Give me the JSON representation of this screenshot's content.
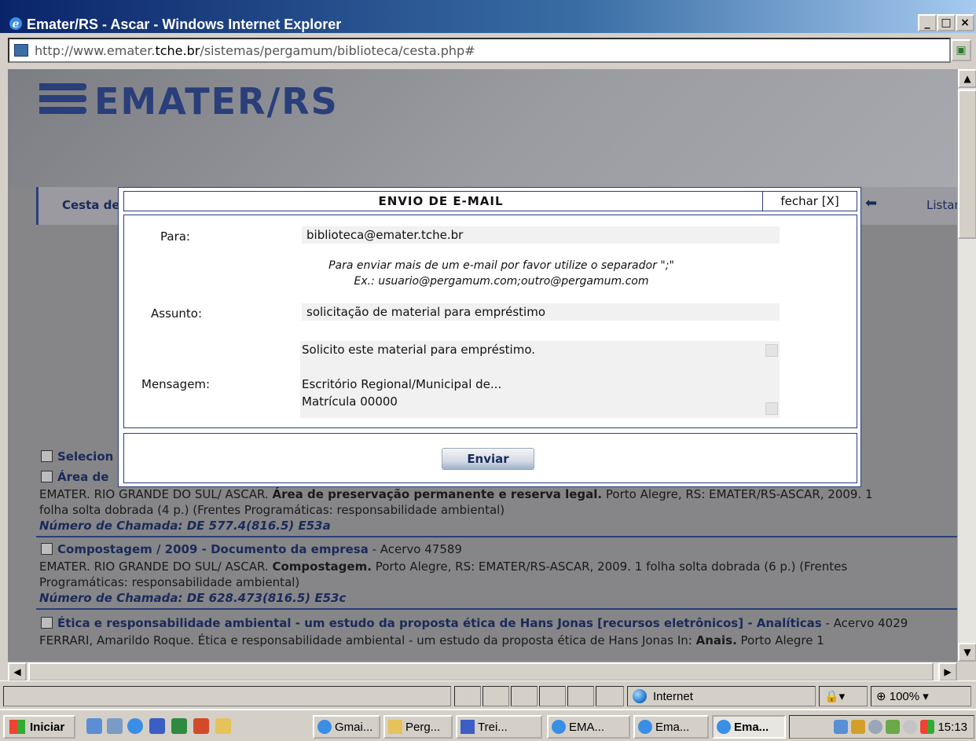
{
  "window": {
    "title": "Emater/RS - Ascar - Windows Internet Explorer",
    "url_prefix": "http://www.emater.",
    "url_host": "tche.br",
    "url_path": "/sistemas/pergamum/biblioteca/cesta.php#"
  },
  "site": {
    "logo_text": "EMATER/RS",
    "nav_left": "Cesta de",
    "nav_right": "Listar"
  },
  "modal": {
    "title": "ENVIO DE E-MAIL",
    "close_label": "fechar [X]",
    "to_label": "Para:",
    "to_value": "biblioteca@emater.tche.br",
    "hint_line1": "Para enviar mais de um e-mail por favor utilize o separador \";\"",
    "hint_line2": "Ex.: usuario@pergamum.com;outro@pergamum.com",
    "subject_label": "Assunto:",
    "subject_value": "solicitação de material para empréstimo",
    "message_label": "Mensagem:",
    "message_lines": [
      "Solicito este material para empréstimo.",
      "",
      "Escritório Regional/Municipal de...",
      "Matrícula 00000"
    ],
    "send_label": "Enviar"
  },
  "results": {
    "select_all_fragment": "Selecion",
    "item1_title_fragment": "Área de",
    "item1_meta_prefix": "EMATER. RIO GRANDE DO SUL/ ASCAR. ",
    "item1_meta_bold": "Área de preservação permanente e reserva legal.",
    "item1_meta_suffix": " Porto Alegre, RS: EMATER/RS-ASCAR, 2009. 1",
    "item1_meta_line2": "folha solta dobrada (4 p.) (Frentes Programáticas: responsabilidade ambiental)",
    "item1_call": "Número de Chamada: DE 577.4(816.5) E53a",
    "item2_title": "Compostagem / 2009 - Documento da empresa",
    "item2_acervo": " - Acervo 47589",
    "item2_meta_prefix": "EMATER. RIO GRANDE DO SUL/ ASCAR. ",
    "item2_meta_bold": "Compostagem.",
    "item2_meta_suffix": " Porto Alegre, RS: EMATER/RS-ASCAR, 2009. 1 folha solta dobrada (6 p.) (Frentes",
    "item2_meta_line2": "Programáticas: responsabilidade ambiental)",
    "item2_call": "Número de Chamada: DE 628.473(816.5) E53c",
    "item3_title": "Ética e responsabilidade ambiental - um estudo da proposta ética de Hans Jonas [recursos eletrônicos] - Analíticas",
    "item3_acervo": " - Acervo 4029",
    "item3_meta_prefix": "FERRARI, Amarildo Roque. Ética e responsabilidade ambiental - um estudo da proposta ética de Hans Jonas In: ",
    "item3_meta_bold": "Anais.",
    "item3_meta_suffix": " Porto Alegre 1"
  },
  "statusbar": {
    "zone": "Internet",
    "zoom": "100%"
  },
  "taskbar": {
    "start": "Iniciar",
    "tasks": [
      "Gmai...",
      "Perg...",
      "Trei...",
      "EMA...",
      "Ema...",
      "Ema..."
    ],
    "clock": "15:13"
  },
  "colors": {
    "brand": "#2a3e7a",
    "title_bar": "#0a246a",
    "page_bg": "#868688"
  }
}
